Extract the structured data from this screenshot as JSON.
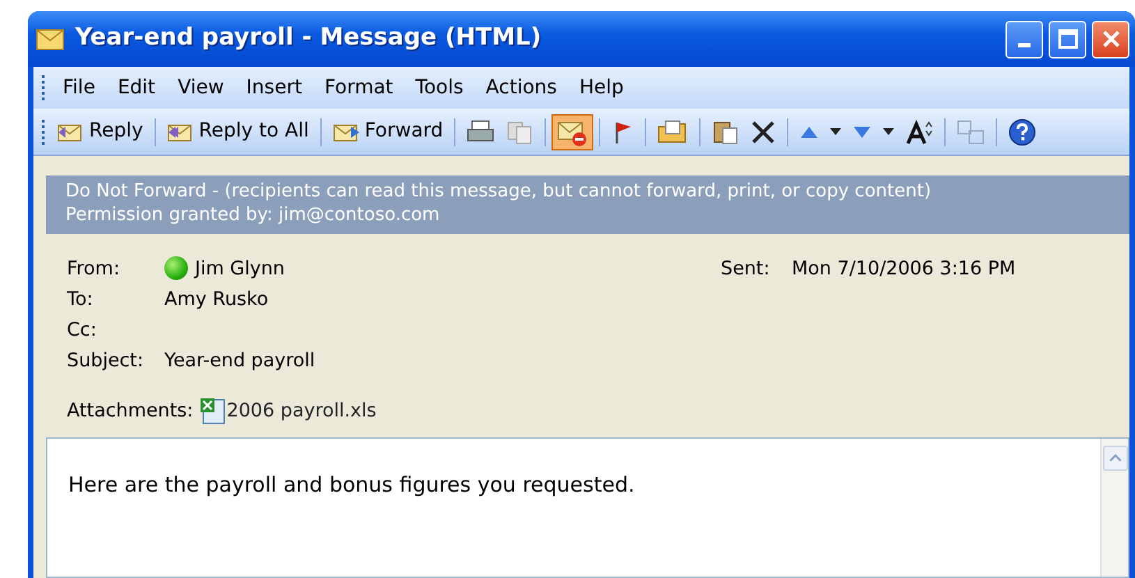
{
  "window": {
    "title": "Year-end payroll - Message (HTML)"
  },
  "menu": [
    "File",
    "Edit",
    "View",
    "Insert",
    "Format",
    "Tools",
    "Actions",
    "Help"
  ],
  "toolbar": {
    "buttons": [
      {
        "label": "Reply"
      },
      {
        "label": "Reply to All"
      },
      {
        "label": "Forward"
      }
    ],
    "permission_pressed": true
  },
  "permission_banner": {
    "line_1": "Do Not Forward - (recipients can read this message, but cannot forward, print, or copy content)",
    "line_2": "Permission granted by: jim@contoso.com"
  },
  "header": {
    "from_label": "From:",
    "from": "Jim Glynn",
    "sender_online": true,
    "sent_label": "Sent:",
    "sent": "Mon 7/10/2006 3:16 PM",
    "to_label": "To:",
    "to": "Amy Rusko",
    "cc_label": "Cc:",
    "subject_label": "Subject:",
    "subject": "Year-end payroll",
    "attachments_label": "Attachments:",
    "attachment": "2006 payroll.xls"
  },
  "body": "Here are the payroll and bonus figures you requested."
}
